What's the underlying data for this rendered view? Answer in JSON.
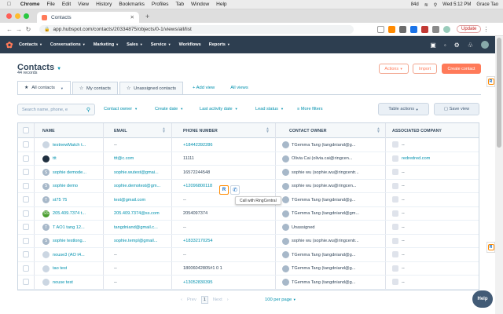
{
  "mac": {
    "app": "Chrome",
    "menus": [
      "File",
      "Edit",
      "View",
      "History",
      "Bookmarks",
      "Profiles",
      "Tab",
      "Window",
      "Help"
    ],
    "battery": "84d",
    "datetime": "Wed 5:12 PM",
    "user": "Grace Tao"
  },
  "browser": {
    "tab_title": "Contacts",
    "url": "app.hubspot.com/contacts/20334875/objects/0-1/views/all/list",
    "update_label": "Update"
  },
  "hubspot_nav": {
    "items": [
      "Contacts",
      "Conversations",
      "Marketing",
      "Sales",
      "Service",
      "Workflows",
      "Reports"
    ]
  },
  "page": {
    "title": "Contacts",
    "records": "44 records",
    "actions_label": "Actions",
    "import_label": "Import",
    "create_label": "Create contact"
  },
  "view_tabs": {
    "all": "All contacts",
    "mine": "My contacts",
    "unassigned": "Unassigned contacts",
    "add_view": "+ Add view",
    "all_views": "All views"
  },
  "filters": {
    "search_placeholder": "Search name, phone, e",
    "contact_owner": "Contact owner",
    "create_date": "Create date",
    "last_activity": "Last activity date",
    "lead_status": "Lead status",
    "more": "More filters",
    "table_actions": "Table actions",
    "save_view": "Save view"
  },
  "table": {
    "headers": [
      "NAME",
      "EMAIL",
      "PHONE NUMBER",
      "CONTACT OWNER",
      "ASSOCIATED COMPANY"
    ],
    "rows": [
      {
        "initial": "",
        "name": "testnewMatch t...",
        "email": "--",
        "phone": "+18442392286",
        "phone_link": true,
        "owner": "TGemma Tang (tangdniand@g...",
        "company": "--"
      },
      {
        "initial": "",
        "name": "ttt",
        "email": "ttt@c.com",
        "phone": "11111",
        "phone_link": false,
        "owner": "Olivia Cai (olivia.cai@ringcen...",
        "company": "redredred.com"
      },
      {
        "initial": "S",
        "name": "sophie demode...",
        "email": "sophie.wutest@gmai...",
        "phone": "16572244548",
        "phone_link": false,
        "owner": "sophie wu (sophie.wu@ringcentr...",
        "company": "--"
      },
      {
        "initial": "S",
        "name": "sophie demo",
        "email": "sophie.demotest@gm...",
        "phone": "+12096800118",
        "phone_link": true,
        "owner": "sophie wu (sophie.wu@ringcen...",
        "company": "--"
      },
      {
        "initial": "T",
        "name": "st75 75",
        "email": "test@gmail.com",
        "phone": "--",
        "phone_link": false,
        "owner": "TGemma Tang (tangdniand@g...",
        "company": "--"
      },
      {
        "initial": "SS",
        "name": "205.409.7374 t...",
        "email": "205.409.7374@ss.com",
        "phone": "2054097374",
        "phone_link": false,
        "owner": "TGemma Tang (tangdniand@gm...",
        "company": "--"
      },
      {
        "initial": "T",
        "name": "T AO1 tang 12...",
        "email": "tangdniand@gmail.c...",
        "phone": "--",
        "phone_link": false,
        "owner": "Unassigned",
        "company": "--"
      },
      {
        "initial": "S",
        "name": "sophie testlong...",
        "email": "sophie.templ@gmail...",
        "phone": "+18332170254",
        "phone_link": true,
        "owner": "sophie wu (sophie.wu@ringcentr...",
        "company": "--"
      },
      {
        "initial": "",
        "name": "nouse3 (AO t4...",
        "email": "--",
        "phone": "--",
        "phone_link": false,
        "owner": "TGemma Tang (tangdniand@g...",
        "company": "--"
      },
      {
        "initial": "",
        "name": "tao test",
        "email": "--",
        "phone": "18006042805#1 0 1",
        "phone_link": false,
        "owner": "TGemma Tang (tangdniand@g...",
        "company": "--"
      },
      {
        "initial": "",
        "name": "nouse test",
        "email": "--",
        "phone": "+13052830395",
        "phone_link": true,
        "owner": "TGemma Tang (tangdniand@g...",
        "company": "--"
      }
    ]
  },
  "ringcentral": {
    "icon_letter": "R",
    "tooltip": "Call with RingCentral"
  },
  "pager": {
    "prev": "Prev",
    "page": "1",
    "next": "Next",
    "per_page": "100 per page"
  },
  "help_label": "Help",
  "colors": {
    "accent": "#ff7a59",
    "nav_bg": "#2d3e50",
    "link": "#0091ae",
    "ringcentral_orange": "#ff8a00"
  }
}
